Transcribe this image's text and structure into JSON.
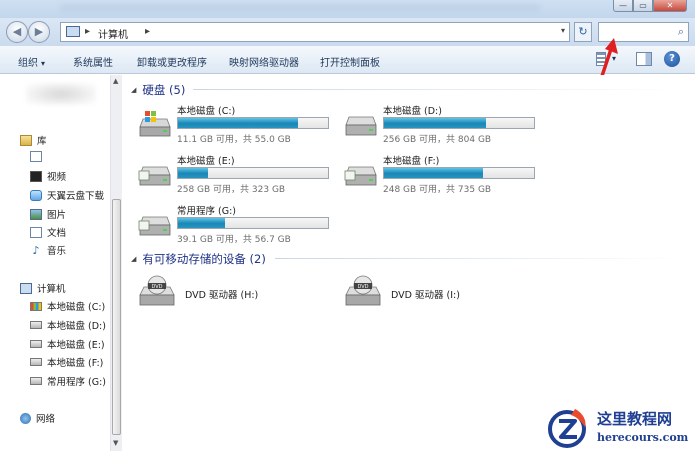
{
  "window": {
    "min_glyph": "—",
    "max_glyph": "▭",
    "close_glyph": "✕"
  },
  "address": {
    "back_glyph": "◀",
    "forward_glyph": "▶",
    "sep": "▸",
    "location": "计算机",
    "dropdown_glyph": "▾",
    "refresh_glyph": "↻",
    "search_placeholder": "",
    "search_icon": "⌕"
  },
  "toolbar": {
    "organize": "组织",
    "caret": "▾",
    "items": [
      "系统属性",
      "卸载或更改程序",
      "映射网络驱动器",
      "打开控制面板"
    ],
    "help": "?"
  },
  "sidebar": {
    "libraries": {
      "label": "库",
      "icon": "library-icon"
    },
    "lib_items": [
      {
        "label": "",
        "icon": "document-icon"
      },
      {
        "label": "视频",
        "icon": "video-icon"
      },
      {
        "label": "天翼云盘下载",
        "icon": "cloud-icon"
      },
      {
        "label": "图片",
        "icon": "picture-icon"
      },
      {
        "label": "文档",
        "icon": "document-icon"
      },
      {
        "label": "音乐",
        "icon": "music-icon"
      }
    ],
    "computer": {
      "label": "计算机",
      "icon": "computer-icon"
    },
    "drives": [
      {
        "label": "本地磁盘 (C:)",
        "icon": "windows-drive-icon"
      },
      {
        "label": "本地磁盘 (D:)",
        "icon": "drive-icon"
      },
      {
        "label": "本地磁盘 (E:)",
        "icon": "drive-icon"
      },
      {
        "label": "本地磁盘 (F:)",
        "icon": "drive-icon"
      },
      {
        "label": "常用程序 (G:)",
        "icon": "drive-icon"
      }
    ],
    "network": {
      "label": "网络",
      "icon": "network-icon"
    },
    "music_glyph": "♪",
    "scroll_up": "▲",
    "scroll_down": "▼",
    "grip": "≡"
  },
  "main": {
    "group_tri": "◢",
    "hard_disks_header": "硬盘 (5)",
    "removable_header": "有可移动存储的设备 (2)",
    "drives": [
      {
        "name": "本地磁盘 (C:)",
        "capacity": "11.1 GB 可用，共 55.0 GB",
        "used_fraction": 0.8,
        "icon": "windows-drive-icon"
      },
      {
        "name": "本地磁盘 (D:)",
        "capacity": "256 GB 可用，共 804 GB",
        "used_fraction": 0.68,
        "icon": "drive-icon"
      },
      {
        "name": "本地磁盘 (E:)",
        "capacity": "258 GB 可用，共 323 GB",
        "used_fraction": 0.2,
        "icon": "drive-icon"
      },
      {
        "name": "本地磁盘 (F:)",
        "capacity": "248 GB 可用，共 735 GB",
        "used_fraction": 0.66,
        "icon": "drive-icon"
      },
      {
        "name": "常用程序 (G:)",
        "capacity": "39.1 GB 可用，共 56.7 GB",
        "used_fraction": 0.31,
        "icon": "drive-icon"
      }
    ],
    "dvds": [
      {
        "name": "DVD 驱动器 (H:)",
        "icon": "dvd-drive-icon"
      },
      {
        "name": "DVD 驱动器 (I:)",
        "icon": "dvd-drive-icon"
      }
    ]
  },
  "watermark": {
    "title": "这里教程网",
    "url": "herecours.com"
  },
  "colors": {
    "accent": "#1e3287",
    "bar_fill": "#1a86b6",
    "annotation": "#e02020"
  }
}
